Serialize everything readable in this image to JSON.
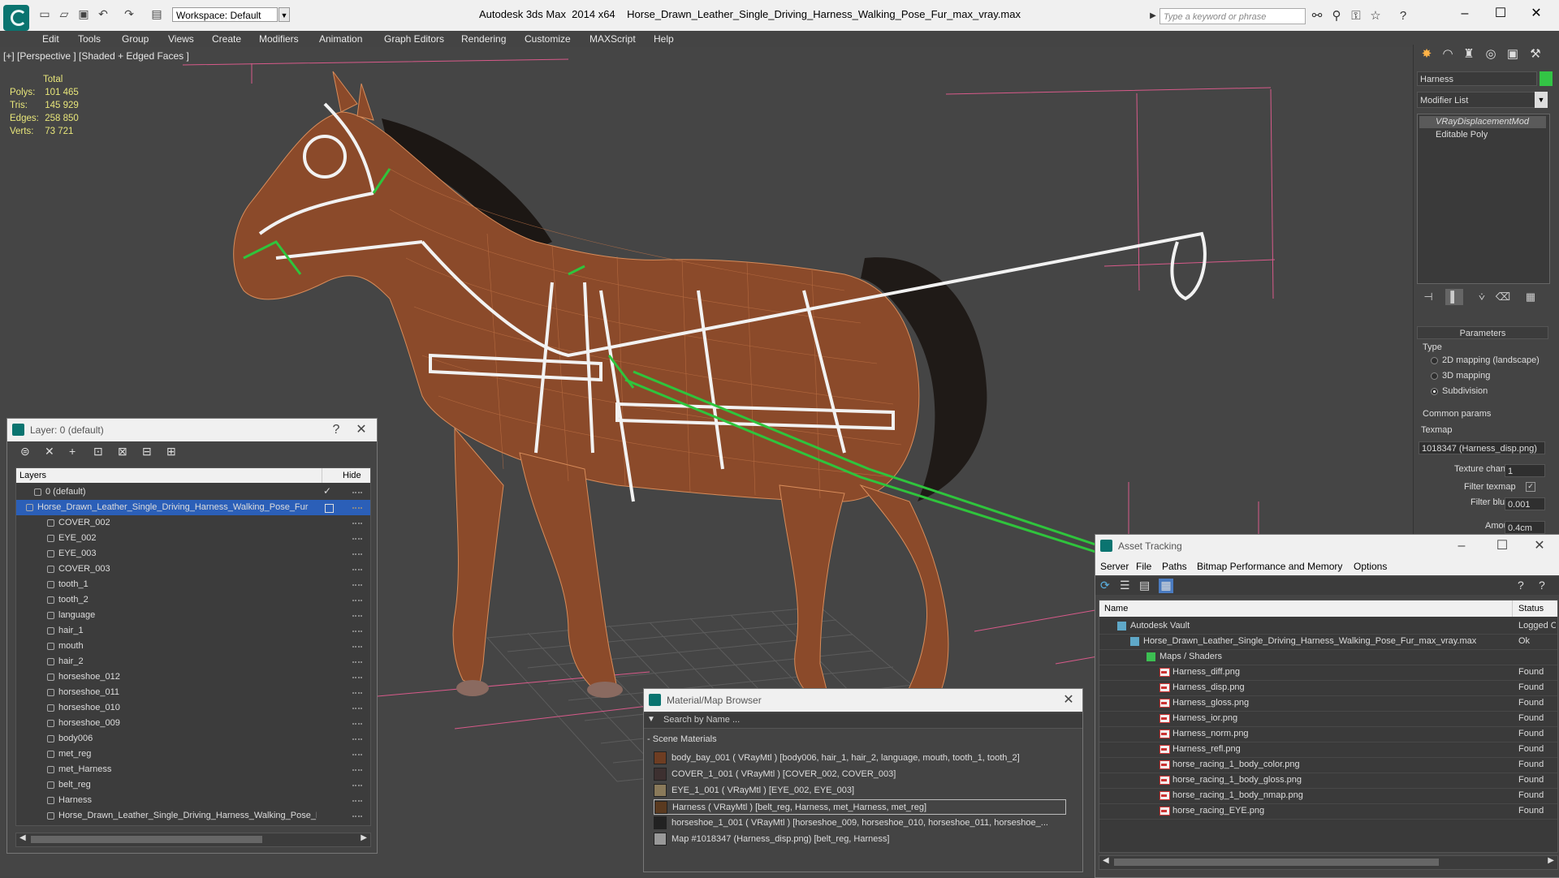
{
  "titlebar": {
    "workspace": "Workspace: Default",
    "app": "Autodesk 3ds Max  2014 x64",
    "file": "Horse_Drawn_Leather_Single_Driving_Harness_Walking_Pose_Fur_max_vray.max",
    "search_placeholder": "Type a keyword or phrase"
  },
  "menu": [
    "Edit",
    "Tools",
    "Group",
    "Views",
    "Create",
    "Modifiers",
    "Animation",
    "Graph Editors",
    "Rendering",
    "Customize",
    "MAXScript",
    "Help"
  ],
  "viewport": {
    "label": "[+] [Perspective ] [Shaded + Edged Faces ]",
    "stats": {
      "header": "Total",
      "rows": [
        {
          "label": "Polys:",
          "value": "101 465"
        },
        {
          "label": "Tris:",
          "value": "145 929"
        },
        {
          "label": "Edges:",
          "value": "258 850"
        },
        {
          "label": "Verts:",
          "value": "73 721"
        }
      ]
    }
  },
  "command_panel": {
    "object_name": "Harness",
    "modifier_list": "Modifier List",
    "stack": [
      "VRayDisplacementMod",
      "Editable Poly"
    ],
    "parameters": {
      "title": "Parameters",
      "type_label": "Type",
      "options": [
        "2D mapping (landscape)",
        "3D mapping",
        "Subdivision"
      ],
      "selected": "Subdivision",
      "common_label": "Common params",
      "texmap_label": "Texmap",
      "texmap_value": "1018347 (Harness_disp.png)",
      "texture_chan_label": "Texture chan",
      "texture_chan_value": "1",
      "filter_texmap_label": "Filter texmap",
      "filter_blur_label": "Filter blur",
      "filter_blur_value": "0.001",
      "amount_label": "Amount",
      "amount_value": "0.4cm"
    }
  },
  "layer_dialog": {
    "title": "Layer: 0 (default)",
    "help": "?",
    "col_layers": "Layers",
    "col_hide": "Hide",
    "rows": [
      "0 (default)",
      "Horse_Drawn_Leather_Single_Driving_Harness_Walking_Pose_Fur",
      "COVER_002",
      "EYE_002",
      "EYE_003",
      "COVER_003",
      "tooth_1",
      "tooth_2",
      "language",
      "hair_1",
      "mouth",
      "hair_2",
      "horseshoe_012",
      "horseshoe_011",
      "horseshoe_010",
      "horseshoe_009",
      "body006",
      "met_reg",
      "met_Harness",
      "belt_reg",
      "Harness",
      "Horse_Drawn_Leather_Single_Driving_Harness_Walking_Pose_Fur"
    ]
  },
  "material_browser": {
    "title": "Material/Map Browser",
    "search_placeholder": "Search by Name ...",
    "section": "Scene Materials",
    "items": [
      "body_bay_001  ( VRayMtl ) [body006, hair_1, hair_2, language, mouth, tooth_1, tooth_2]",
      "COVER_1_001  ( VRayMtl ) [COVER_002, COVER_003]",
      "EYE_1_001  ( VRayMtl ) [EYE_002, EYE_003]",
      "Harness  ( VRayMtl ) [belt_reg, Harness, met_Harness, met_reg]",
      "horseshoe_1_001  ( VRayMtl ) [horseshoe_009, horseshoe_010, horseshoe_011, horseshoe_...",
      "Map #1018347 (Harness_disp.png) [belt_reg, Harness]"
    ]
  },
  "asset_tracking": {
    "title": "Asset Tracking",
    "menu": [
      "Server",
      "File",
      "Paths",
      "Bitmap Performance and Memory",
      "Options"
    ],
    "col_name": "Name",
    "col_status": "Status",
    "rows": [
      {
        "name": "Autodesk Vault",
        "status": "Logged O"
      },
      {
        "name": "Horse_Drawn_Leather_Single_Driving_Harness_Walking_Pose_Fur_max_vray.max",
        "status": "Ok"
      },
      {
        "name": "Maps / Shaders",
        "status": ""
      },
      {
        "name": "Harness_diff.png",
        "status": "Found"
      },
      {
        "name": "Harness_disp.png",
        "status": "Found"
      },
      {
        "name": "Harness_gloss.png",
        "status": "Found"
      },
      {
        "name": "Harness_ior.png",
        "status": "Found"
      },
      {
        "name": "Harness_norm.png",
        "status": "Found"
      },
      {
        "name": "Harness_refl.png",
        "status": "Found"
      },
      {
        "name": "horse_racing_1_body_color.png",
        "status": "Found"
      },
      {
        "name": "horse_racing_1_body_gloss.png",
        "status": "Found"
      },
      {
        "name": "horse_racing_1_body_nmap.png",
        "status": "Found"
      },
      {
        "name": "horse_racing_EYE.png",
        "status": "Found"
      }
    ]
  }
}
